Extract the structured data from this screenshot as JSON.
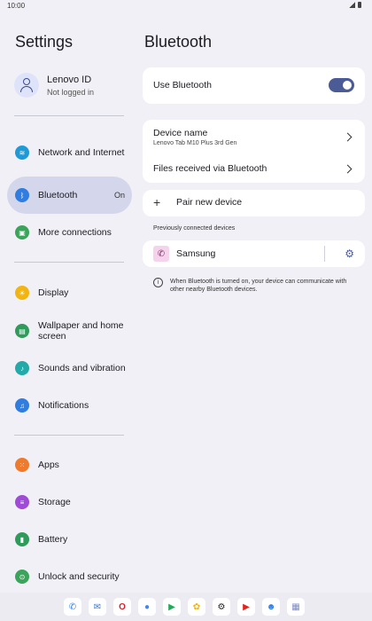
{
  "statusbar": {
    "time": "10:00"
  },
  "left": {
    "title": "Settings",
    "account": {
      "name": "Lenovo ID",
      "status": "Not logged in"
    },
    "items": [
      {
        "label": "Network and Internet",
        "icon": "wifi-icon",
        "color": "#1e9bd7"
      },
      {
        "label": "Bluetooth",
        "icon": "bluetooth-icon",
        "color": "#2f7de1",
        "badge": "On",
        "active": true
      },
      {
        "label": "More connections",
        "icon": "connections-icon",
        "color": "#3aa45a"
      },
      {
        "label": "Display",
        "icon": "display-icon",
        "color": "#f2b40f"
      },
      {
        "label": "Wallpaper and home screen",
        "icon": "wallpaper-icon",
        "color": "#2e9b5b"
      },
      {
        "label": "Sounds and vibration",
        "icon": "sound-icon",
        "color": "#22a9a8"
      },
      {
        "label": "Notifications",
        "icon": "bell-icon",
        "color": "#2f7de1"
      },
      {
        "label": "Apps",
        "icon": "apps-icon",
        "color": "#f07a2b"
      },
      {
        "label": "Storage",
        "icon": "storage-icon",
        "color": "#a04ad8"
      },
      {
        "label": "Battery",
        "icon": "battery-icon",
        "color": "#2e9b5b"
      },
      {
        "label": "Unlock and security",
        "icon": "lock-icon",
        "color": "#3aa45a"
      }
    ]
  },
  "right": {
    "title": "Bluetooth",
    "use_bluetooth": {
      "label": "Use Bluetooth",
      "enabled": true
    },
    "device_name": {
      "label": "Device name",
      "value": "Lenovo Tab M10 Plus 3rd Gen"
    },
    "files_received": {
      "label": "Files received via Bluetooth"
    },
    "pair_new": {
      "label": "Pair new device"
    },
    "previously_connected_label": "Previously connected devices",
    "devices": [
      {
        "name": "Samsung",
        "icon": "phone-icon"
      }
    ],
    "info_text": "When Bluetooth is turned on, your device can communicate with other nearby Bluetooth devices."
  },
  "dock": {
    "apps": [
      {
        "name": "phone-app-icon",
        "glyph": "✆",
        "color": "#2f7de1"
      },
      {
        "name": "messages-app-icon",
        "glyph": "✉",
        "color": "#2f7de1"
      },
      {
        "name": "opera-app-icon",
        "glyph": "O",
        "color": "#d9202a"
      },
      {
        "name": "assistant-app-icon",
        "glyph": "●",
        "color": "#4285f4"
      },
      {
        "name": "play-store-app-icon",
        "glyph": "▶",
        "color": "#1faa59"
      },
      {
        "name": "photos-app-icon",
        "glyph": "✿",
        "color": "#f4b400"
      },
      {
        "name": "settings-app-icon",
        "glyph": "⚙",
        "color": "#222"
      },
      {
        "name": "youtube-music-app-icon",
        "glyph": "▶",
        "color": "#e62117"
      },
      {
        "name": "contacts-app-icon",
        "glyph": "☻",
        "color": "#2f7de1"
      },
      {
        "name": "app-drawer-icon",
        "glyph": "▦",
        "color": "#7b8cc7"
      }
    ]
  }
}
